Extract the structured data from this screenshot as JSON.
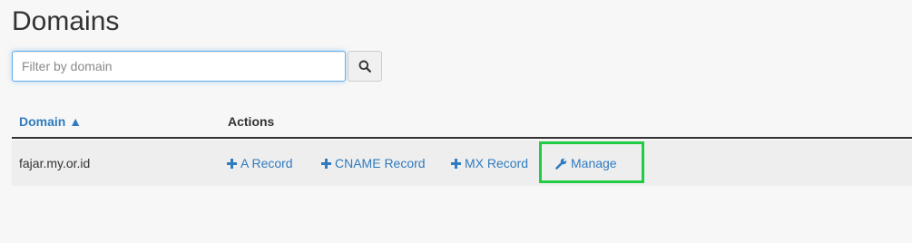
{
  "page": {
    "title": "Domains"
  },
  "search": {
    "placeholder": "Filter by domain",
    "value": ""
  },
  "table": {
    "headers": {
      "domain": "Domain ▲",
      "actions": "Actions"
    },
    "rows": [
      {
        "domain": "fajar.my.or.id",
        "actions": {
          "a_record": "A Record",
          "cname_record": "CNAME Record",
          "mx_record": "MX Record",
          "manage": "Manage"
        }
      }
    ]
  },
  "colors": {
    "link": "#2f7bbf",
    "highlight": "#22cc44",
    "row_background": "#eeeeee",
    "page_background": "#f7f7f7"
  },
  "icons": {
    "search": "search-icon",
    "add": "plus-icon",
    "manage": "wrench-icon"
  }
}
